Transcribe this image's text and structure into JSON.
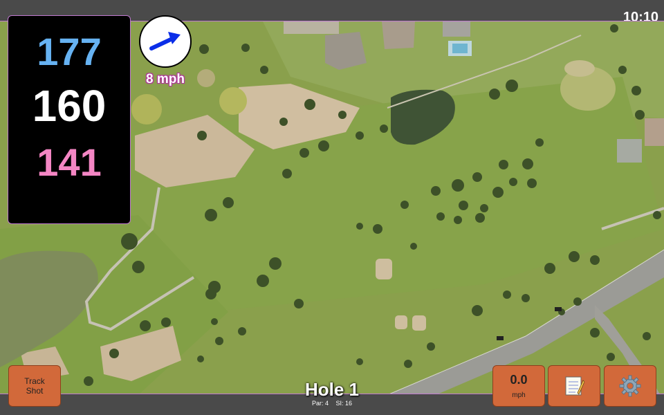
{
  "status": {
    "time": "10:10"
  },
  "distances": {
    "back": "177",
    "center": "160",
    "front": "141"
  },
  "wind": {
    "speed": "8 mph",
    "icon": "wind-direction-arrow-icon"
  },
  "hole": {
    "title": "Hole 1",
    "par": "Par: 4",
    "si": "SI: 16"
  },
  "buttons": {
    "track_shot_line1": "Track",
    "track_shot_line2": "Shot",
    "speed_value": "0.0",
    "speed_unit": "mph",
    "notes_icon": "notepad-icon",
    "settings_icon": "gear-icon"
  },
  "colors": {
    "back_distance": "#66b2f2",
    "center_distance": "#ffffff",
    "front_distance": "#f486c4",
    "button": "#d2693a"
  }
}
